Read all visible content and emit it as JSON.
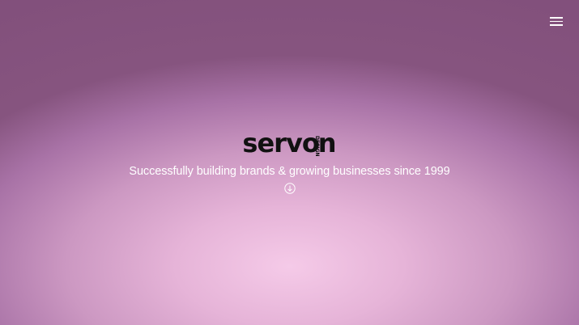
{
  "logo": {
    "main": "servo",
    "vertical": "DESIGN",
    "end": "n"
  },
  "hero": {
    "tagline": "Successfully building brands & growing businesses since 1999"
  },
  "icons": {
    "menu": "hamburger-icon",
    "scroll": "arrow-down-circle-icon"
  },
  "colors": {
    "background_light": "#f5cae8",
    "background_dark": "#86547f",
    "text": "#ffffff",
    "logo": "#111111"
  }
}
